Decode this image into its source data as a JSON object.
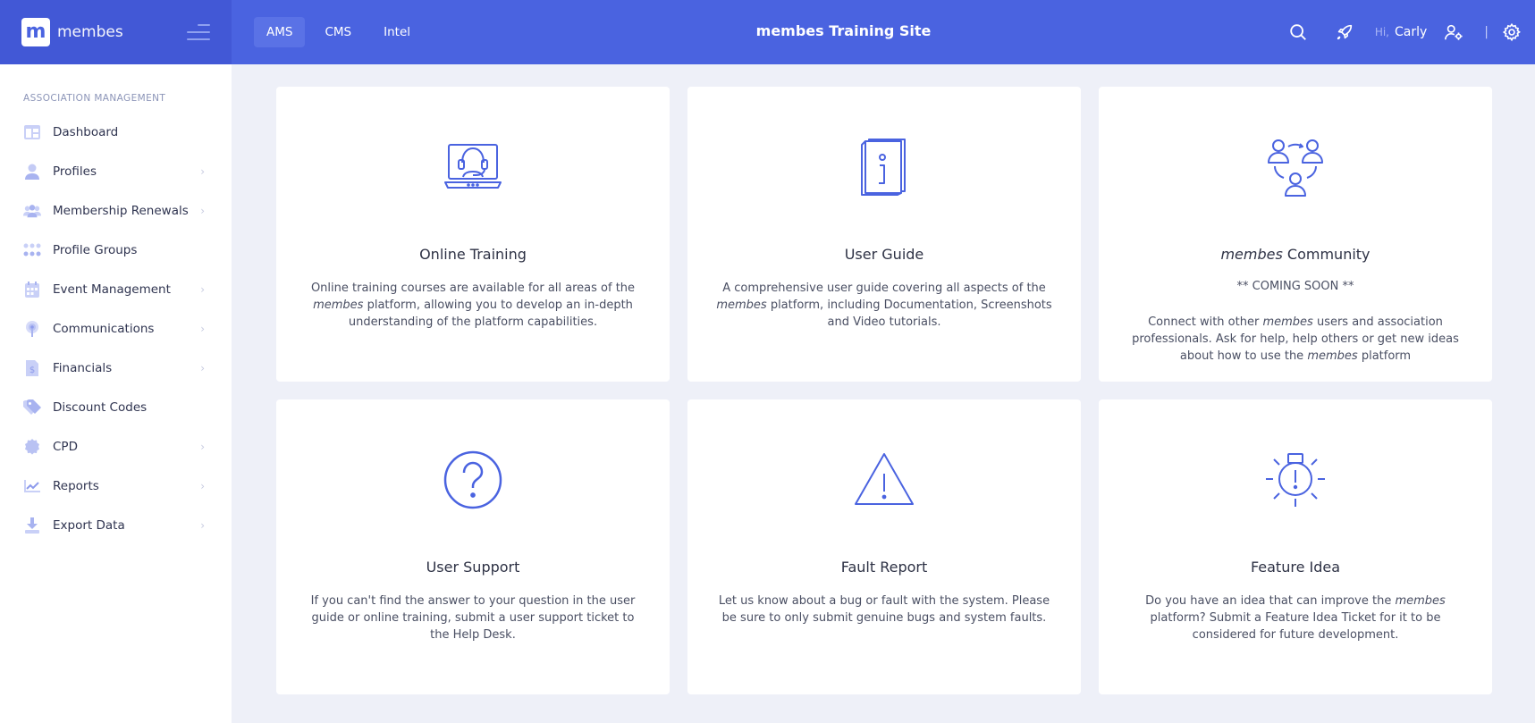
{
  "header": {
    "logo_letter": "m",
    "logo_text": "membes",
    "tabs": [
      {
        "label": "AMS"
      },
      {
        "label": "CMS"
      },
      {
        "label": "Intel"
      }
    ],
    "site_title": "membes Training Site",
    "greeting": "Hi,",
    "user_name": "Carly",
    "separator": "|"
  },
  "sidebar": {
    "section_title": "ASSOCIATION MANAGEMENT",
    "items": [
      {
        "label": "Dashboard",
        "icon": "dashboard-icon"
      },
      {
        "label": "Profiles",
        "icon": "profile-icon"
      },
      {
        "label": "Membership Renewals",
        "icon": "group-icon"
      },
      {
        "label": "Profile Groups",
        "icon": "grid-icon"
      },
      {
        "label": "Event Management",
        "icon": "calendar-icon"
      },
      {
        "label": "Communications",
        "icon": "broadcast-icon"
      },
      {
        "label": "Financials",
        "icon": "invoice-icon"
      },
      {
        "label": "Discount Codes",
        "icon": "tag-icon"
      },
      {
        "label": "CPD",
        "icon": "badge-icon"
      },
      {
        "label": "Reports",
        "icon": "chart-icon"
      },
      {
        "label": "Export Data",
        "icon": "download-icon"
      }
    ]
  },
  "cards": {
    "training": {
      "title": "Online Training",
      "desc_1": "Online training courses are available for all areas of the",
      "desc_em": "membes",
      "desc_2": "platform, allowing you to develop an in-depth understanding of the platform capabilities."
    },
    "guide": {
      "title": "User Guide",
      "desc_1": "A comprehensive user guide covering all aspects of the",
      "desc_em": "membes",
      "desc_2": "platform, including Documentation, Screenshots and Video tutorials."
    },
    "community": {
      "title_em": "membes",
      "title_rest": "Community",
      "subtitle": "** COMING SOON **",
      "desc_1": "Connect with other",
      "desc_em_1": "membes",
      "desc_2": "users and association professionals. Ask for help, help others or get new ideas about how to use the",
      "desc_em_2": "membes",
      "desc_3": "platform"
    },
    "support": {
      "title": "User Support",
      "desc": "If you can't find the answer to your question in the user guide or online training, submit a user support ticket to the Help Desk."
    },
    "fault": {
      "title": "Fault Report",
      "desc": "Let us know about a bug or fault with the system. Please be sure to only submit genuine bugs and system faults."
    },
    "idea": {
      "title": "Feature Idea",
      "desc_1": "Do you have an idea that can improve the",
      "desc_em": "membes",
      "desc_2": "platform? Submit a Feature Idea Ticket for it to be considered for future development."
    }
  },
  "colors": {
    "header": "#4a63e0",
    "brand": "#4258d6",
    "accent": "#4a63e0",
    "sidebar_icon": "#aab4f0",
    "background": "#eef0f8"
  }
}
